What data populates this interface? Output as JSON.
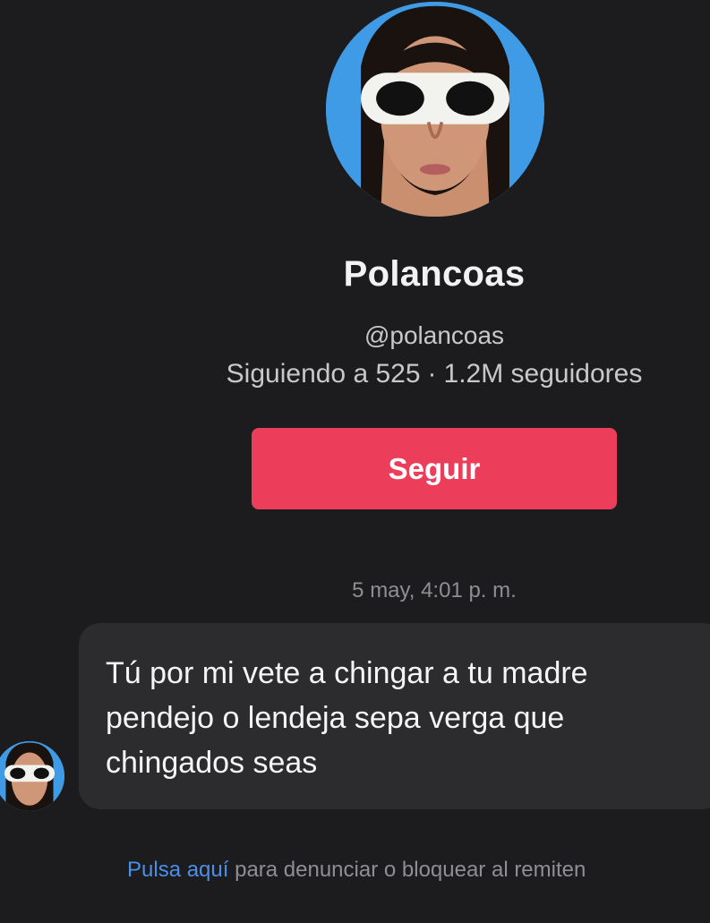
{
  "profile": {
    "display_name": "Polancoas",
    "username": "@polancoas",
    "following_text": "Siguiendo a 525",
    "separator": "·",
    "followers_text": "1.2M seguidores",
    "follow_label": "Seguir"
  },
  "conversation": {
    "timestamp": "5 may, 4:01 p. m.",
    "message": "Tú por mi vete a chingar a tu madre pendejo o lendeja sepa verga que chingados seas"
  },
  "footer": {
    "link_text": "Pulsa aquí",
    "rest_text": " para denunciar o bloquear al remiten"
  },
  "colors": {
    "background": "#1c1c1e",
    "follow_button": "#ec3e5b",
    "bubble": "#2c2c2e",
    "link": "#4a8fe8",
    "avatar_background": "#3f9be6"
  },
  "icons": {
    "profile_avatar": "profile-avatar-icon",
    "sender_avatar": "sender-avatar-icon"
  }
}
